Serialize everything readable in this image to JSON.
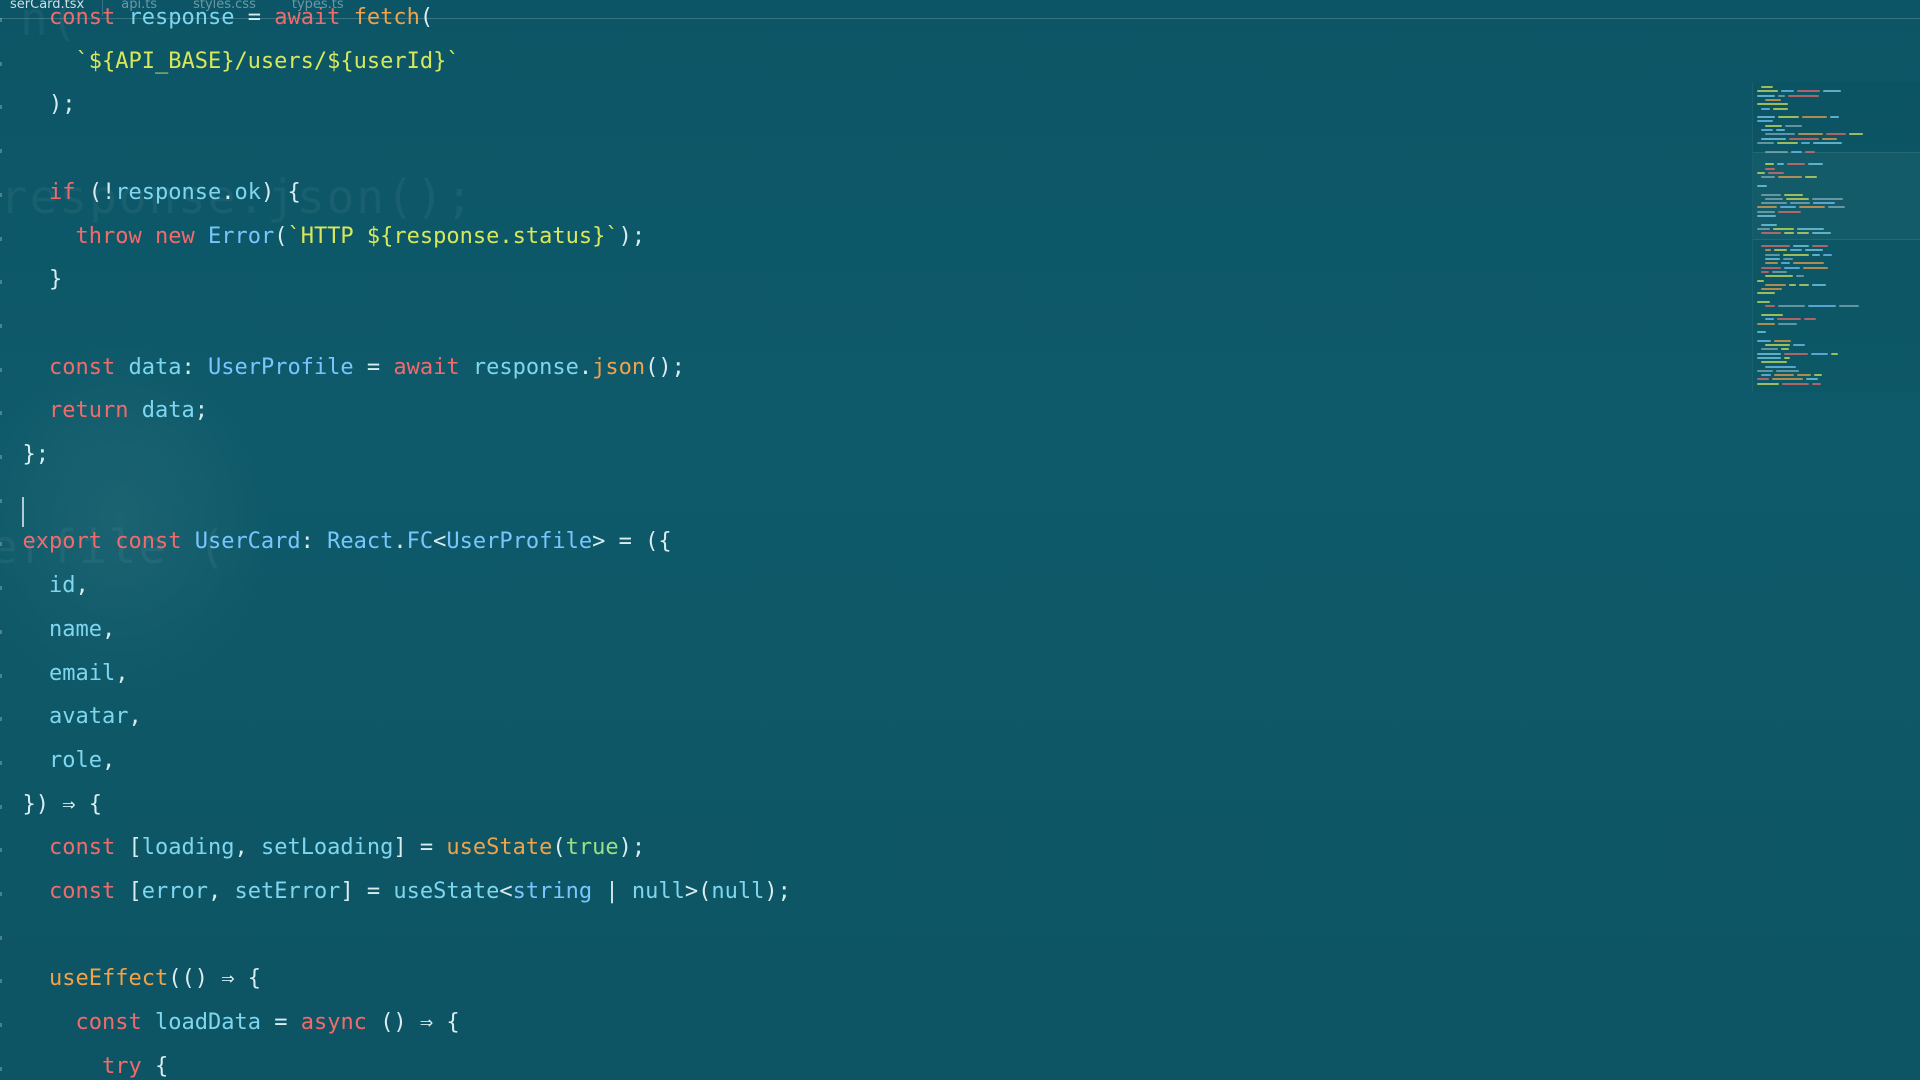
{
  "tabs": [
    {
      "label": "serCard.tsx",
      "active": true
    },
    {
      "label": "api.ts",
      "active": false
    },
    {
      "label": "styles.css",
      "active": false
    },
    {
      "label": "types.ts",
      "active": false
    }
  ],
  "ghost_text": [
    "response.json();",
    "erfile (",
    "n("
  ],
  "lines": [
    [
      {
        "t": "kw",
        "v": "const "
      },
      {
        "t": "var",
        "v": "response "
      },
      {
        "t": "punc",
        "v": "= "
      },
      {
        "t": "kw",
        "v": "await "
      },
      {
        "t": "fn",
        "v": "fetch"
      },
      {
        "t": "punc",
        "v": "("
      }
    ],
    [
      {
        "t": "str",
        "v": "`${API_BASE}/users/${userId}`"
      }
    ],
    [
      {
        "t": "punc",
        "v": ");"
      }
    ],
    [],
    [
      {
        "t": "kw",
        "v": "if "
      },
      {
        "t": "punc",
        "v": "(!"
      },
      {
        "t": "var",
        "v": "response"
      },
      {
        "t": "punc",
        "v": "."
      },
      {
        "t": "var",
        "v": "ok"
      },
      {
        "t": "punc",
        "v": ") {"
      }
    ],
    [
      {
        "t": "kw",
        "v": "throw "
      },
      {
        "t": "kw",
        "v": "new "
      },
      {
        "t": "type",
        "v": "Error"
      },
      {
        "t": "punc",
        "v": "("
      },
      {
        "t": "str",
        "v": "`HTTP ${response.status}`"
      },
      {
        "t": "punc",
        "v": ");"
      }
    ],
    [
      {
        "t": "punc",
        "v": "}"
      }
    ],
    [],
    [
      {
        "t": "kw",
        "v": "const "
      },
      {
        "t": "var",
        "v": "data"
      },
      {
        "t": "punc",
        "v": ": "
      },
      {
        "t": "type",
        "v": "UserProfile"
      },
      {
        "t": "punc",
        "v": " = "
      },
      {
        "t": "kw",
        "v": "await "
      },
      {
        "t": "var",
        "v": "response"
      },
      {
        "t": "punc",
        "v": "."
      },
      {
        "t": "fn",
        "v": "json"
      },
      {
        "t": "punc",
        "v": "();"
      }
    ],
    [
      {
        "t": "kw",
        "v": "return "
      },
      {
        "t": "var",
        "v": "data"
      },
      {
        "t": "punc",
        "v": ";"
      }
    ],
    [
      {
        "t": "punc",
        "v": "};"
      }
    ],
    [],
    [
      {
        "t": "kw",
        "v": "export "
      },
      {
        "t": "kw",
        "v": "const "
      },
      {
        "t": "type",
        "v": "UserCard"
      },
      {
        "t": "punc",
        "v": ": "
      },
      {
        "t": "type",
        "v": "React"
      },
      {
        "t": "punc",
        "v": "."
      },
      {
        "t": "type",
        "v": "FC"
      },
      {
        "t": "punc",
        "v": "<"
      },
      {
        "t": "type",
        "v": "UserProfile"
      },
      {
        "t": "punc",
        "v": "> = ({"
      }
    ],
    [
      {
        "t": "var",
        "v": "id"
      },
      {
        "t": "punc",
        "v": ","
      }
    ],
    [
      {
        "t": "var",
        "v": "name"
      },
      {
        "t": "punc",
        "v": ","
      }
    ],
    [
      {
        "t": "var",
        "v": "email"
      },
      {
        "t": "punc",
        "v": ","
      }
    ],
    [
      {
        "t": "var",
        "v": "avatar"
      },
      {
        "t": "punc",
        "v": ","
      }
    ],
    [
      {
        "t": "var",
        "v": "role"
      },
      {
        "t": "punc",
        "v": ","
      }
    ],
    [
      {
        "t": "punc",
        "v": "}) ⇒ {"
      }
    ],
    [
      {
        "t": "kw",
        "v": "const "
      },
      {
        "t": "punc",
        "v": "["
      },
      {
        "t": "var",
        "v": "loading"
      },
      {
        "t": "punc",
        "v": ", "
      },
      {
        "t": "var",
        "v": "setLoading"
      },
      {
        "t": "punc",
        "v": "] = "
      },
      {
        "t": "fn",
        "v": "useState"
      },
      {
        "t": "punc",
        "v": "("
      },
      {
        "t": "bool",
        "v": "true"
      },
      {
        "t": "punc",
        "v": ");"
      }
    ],
    [
      {
        "t": "kw",
        "v": "const "
      },
      {
        "t": "punc",
        "v": "["
      },
      {
        "t": "var",
        "v": "error"
      },
      {
        "t": "punc",
        "v": ", "
      },
      {
        "t": "var",
        "v": "setError"
      },
      {
        "t": "punc",
        "v": "] = "
      },
      {
        "t": "var",
        "v": "useState"
      },
      {
        "t": "punc",
        "v": "<"
      },
      {
        "t": "type",
        "v": "string"
      },
      {
        "t": "punc",
        "v": " | "
      },
      {
        "t": "var",
        "v": "null"
      },
      {
        "t": "punc",
        "v": ">("
      },
      {
        "t": "var",
        "v": "null"
      },
      {
        "t": "punc",
        "v": ");"
      }
    ],
    [],
    [
      {
        "t": "fn",
        "v": "useEffect"
      },
      {
        "t": "punc",
        "v": "(() ⇒ {"
      }
    ],
    [
      {
        "t": "kw",
        "v": "const "
      },
      {
        "t": "var",
        "v": "loadData"
      },
      {
        "t": "punc",
        "v": " = "
      },
      {
        "t": "kw",
        "v": "async "
      },
      {
        "t": "punc",
        "v": "() ⇒ {"
      }
    ],
    [
      {
        "t": "kw",
        "v": "try "
      },
      {
        "t": "punc",
        "v": "{"
      }
    ]
  ],
  "indents": [
    2,
    3,
    2,
    0,
    2,
    3,
    2,
    0,
    2,
    2,
    1,
    1,
    1,
    2,
    2,
    2,
    2,
    2,
    1,
    2,
    2,
    0,
    2,
    3,
    4
  ],
  "colors": {
    "keyword": "#f26b6b",
    "variable": "#7fd6ef",
    "type": "#79c6ff",
    "function": "#f2a248",
    "string": "#d8e85a",
    "background": "#0e5566"
  }
}
